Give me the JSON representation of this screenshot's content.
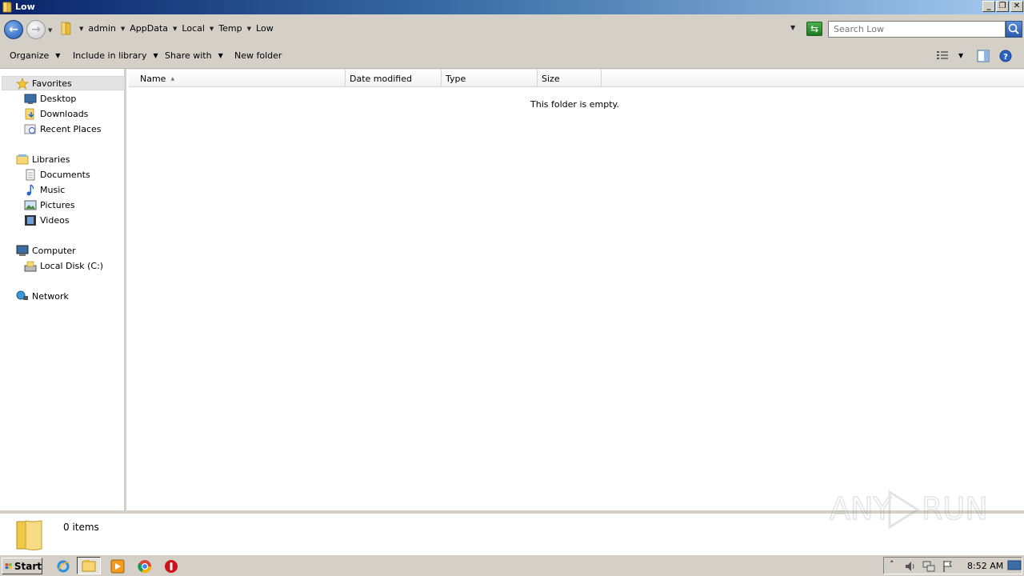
{
  "window": {
    "title": "Low",
    "controls": {
      "minimize": "_",
      "restore": "❐",
      "close": "✕"
    }
  },
  "address": {
    "breadcrumbs": [
      "admin",
      "AppData",
      "Local",
      "Temp",
      "Low"
    ],
    "search_placeholder": "Search Low"
  },
  "toolbar": {
    "organize": "Organize",
    "include_in_library": "Include in library",
    "share_with": "Share with",
    "new_folder": "New folder"
  },
  "nav": {
    "favorites": "Favorites",
    "desktop": "Desktop",
    "downloads": "Downloads",
    "recent_places": "Recent Places",
    "libraries": "Libraries",
    "documents": "Documents",
    "music": "Music",
    "pictures": "Pictures",
    "videos": "Videos",
    "computer": "Computer",
    "local_disk": "Local Disk (C:)",
    "network": "Network"
  },
  "columns": [
    "Name",
    "Date modified",
    "Type",
    "Size"
  ],
  "content": {
    "empty_message": "This folder is empty."
  },
  "details": {
    "item_count": "0 items"
  },
  "taskbar": {
    "start_label": "Start",
    "clock": "8:52 AM"
  },
  "watermark": "ANY RUN",
  "colors": {
    "title_gradient_start": "#0a246a",
    "title_gradient_end": "#a6caf0",
    "chrome": "#d4d0c8"
  }
}
